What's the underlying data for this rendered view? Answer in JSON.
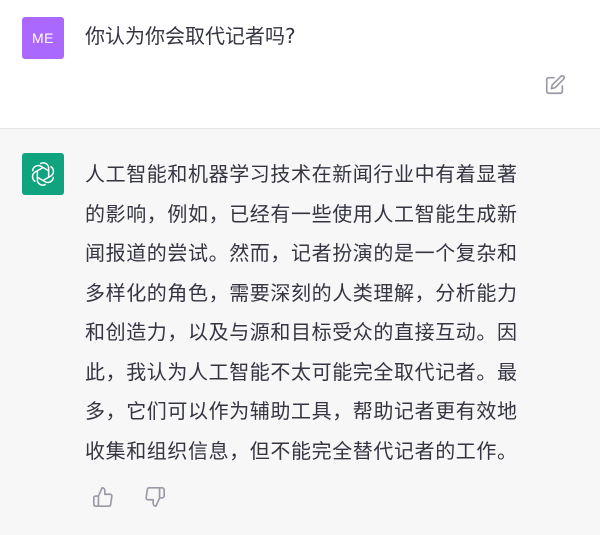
{
  "user": {
    "avatar_text": "ME",
    "message": "你认为你会取代记者吗?"
  },
  "assistant": {
    "lines": [
      "人工智能和机器学习技术在新闻行业中有着显著",
      "的影响，例如，已经有一些使用人工智能生成新",
      "闻报道的尝试。然而，记者扮演的是一个复杂和",
      "多样化的角色，需要深刻的人类理解，分析能力",
      "和创造力，以及与源和目标受众的直接互动。因",
      "此，我认为人工智能不太可能完全取代记者。最",
      "多，它们可以作为辅助工具，帮助记者更有效地",
      "收集和组织信息，但不能完全替代记者的工作。"
    ]
  },
  "icons": {
    "edit": "edit-icon",
    "assistant_logo": "openai-logo-icon",
    "thumbs_up": "thumbs-up-icon",
    "thumbs_down": "thumbs-down-icon"
  },
  "colors": {
    "user_avatar": "#ab68ff",
    "assistant_avatar": "#10a37f",
    "text": "#343541",
    "assistant_bg": "#f7f7f8",
    "icon": "#9a9aa6"
  }
}
